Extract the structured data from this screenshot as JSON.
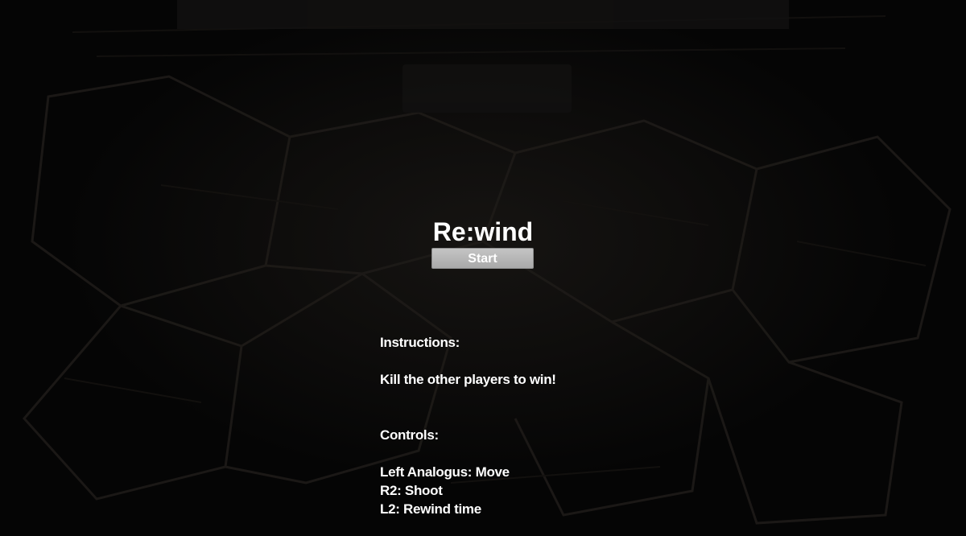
{
  "menu": {
    "title": "Re:wind",
    "start_label": "Start"
  },
  "instructions": {
    "heading": "Instructions:",
    "text": "Kill the other players to win!"
  },
  "controls": {
    "heading": "Controls:",
    "items": [
      "Left Analogus: Move",
      "R2: Shoot",
      "L2: Rewind time"
    ]
  }
}
